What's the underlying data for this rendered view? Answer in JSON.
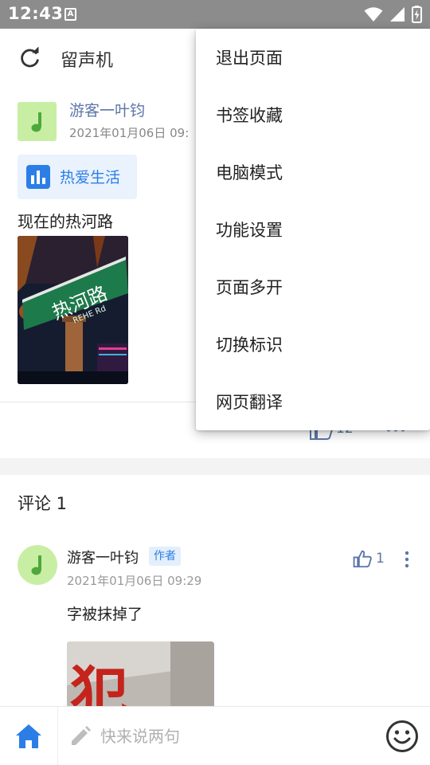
{
  "status_bar": {
    "time": "12:43",
    "notification_glyph": "A",
    "icons": [
      "wifi-icon",
      "signal-icon",
      "battery-charging-icon"
    ]
  },
  "header": {
    "title": "留声机",
    "refresh_icon": "refresh-icon"
  },
  "post": {
    "author": "游客一叶钧",
    "time": "2021年01月06日 09:",
    "avatar_icon": "music-note-icon",
    "tag": {
      "label": "热爱生活",
      "icon": "bar-chart-icon"
    },
    "text": "现在的热河路",
    "photo_sign_text": "热河路",
    "photo_sign_sub": "REHE Rd",
    "like_count": "12"
  },
  "comments": {
    "heading": "评论 1",
    "items": [
      {
        "author": "游客一叶钧",
        "badge": "作者",
        "time": "2021年01月06日 09:29",
        "text": "字被抹掉了",
        "likes": "1",
        "photo_glyph": "犯"
      }
    ]
  },
  "bottom_bar": {
    "input_placeholder": "快来说两句",
    "home_icon": "home-icon",
    "emoji_icon": "emoji-icon",
    "pencil_icon": "pencil-icon"
  },
  "menu": {
    "items": [
      "退出页面",
      "书签收藏",
      "电脑模式",
      "功能设置",
      "页面多开",
      "切换标识",
      "网页翻译"
    ]
  },
  "colors": {
    "status_bar": "#8c8c8c",
    "accent_blue": "#2c7ee6",
    "author_link": "#5c76a8",
    "avatar_green": "#c8eea4",
    "note_green": "#4ea83a",
    "tag_bg": "#e9f2fd"
  }
}
